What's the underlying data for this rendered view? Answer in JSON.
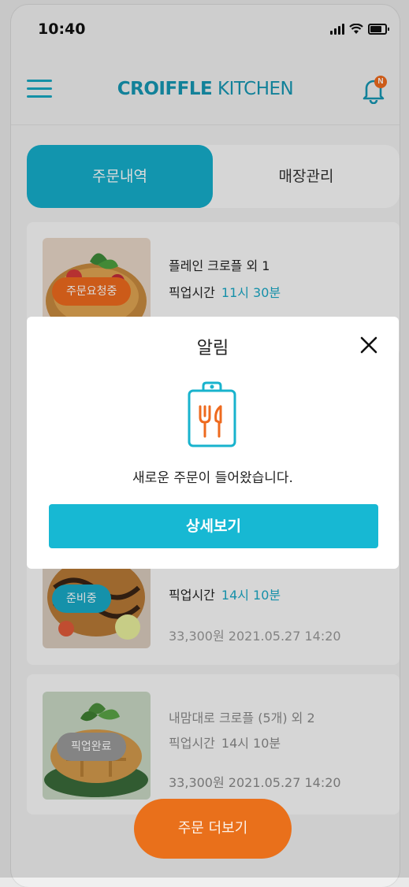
{
  "status": {
    "time": "10:40"
  },
  "header": {
    "brand_bold": "CROIFFLE",
    "brand_light": " KITCHEN",
    "notif_badge": "N"
  },
  "tabs": [
    {
      "label": "주문내역",
      "active": true
    },
    {
      "label": "매장관리",
      "active": false
    }
  ],
  "orders": [
    {
      "title": "플레인 크로플 외 1",
      "pickup_label": "픽업시간",
      "pickup_time": "11시 30분",
      "status": "주문요청중",
      "status_color": "#ee6a1e"
    },
    {
      "title": "",
      "pickup_label": "픽업시간",
      "pickup_time": "14시 10분",
      "price_date": "33,300원  2021.05.27 14:20",
      "status": "준비중",
      "status_color": "#19a9c6"
    },
    {
      "title": "내맘대로 크로플 (5개) 외 2",
      "pickup_label": "픽업시간",
      "pickup_time": "14시 10분",
      "price_date": "33,300원  2021.05.27 14:20",
      "status": "픽업완료",
      "status_color": "#9a9a9a"
    }
  ],
  "more_button": {
    "label": "주문 더보기"
  },
  "modal": {
    "title": "알림",
    "message": "새로운 주문이 들어왔습니다.",
    "button": "상세보기"
  },
  "colors": {
    "accent": "#16aecb",
    "orange": "#ee6a1e",
    "brand": "#1597b3"
  },
  "icons": {
    "menu": "hamburger-icon",
    "bell": "bell-icon",
    "close": "close-icon",
    "clipboard": "clipboard-utensils-icon"
  }
}
